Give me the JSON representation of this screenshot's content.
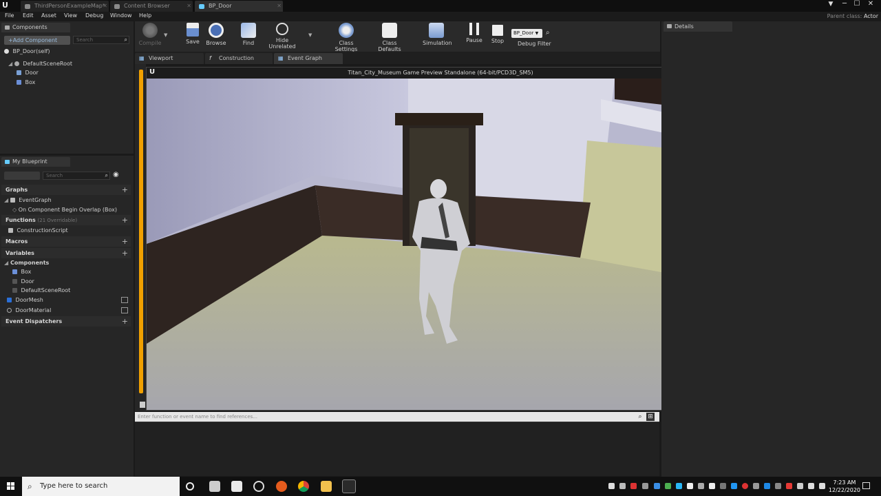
{
  "window": {
    "tabs": [
      {
        "label": "ThirdPersonExampleMap*"
      },
      {
        "label": "Content Browser"
      },
      {
        "label": "BP_Door"
      }
    ],
    "parent_class_label": "Parent class:",
    "parent_class_value": "Actor",
    "controls": {
      "minimize": "─",
      "maximize": "☐",
      "close": "✕"
    }
  },
  "menu": [
    "File",
    "Edit",
    "Asset",
    "View",
    "Debug",
    "Window",
    "Help"
  ],
  "components_panel": {
    "tab_label": "Components",
    "add_button": "+Add Component",
    "search_placeholder": "Search",
    "self_label": "BP_Door(self)",
    "tree": [
      {
        "label": "DefaultSceneRoot",
        "icon": "scene-root-icon"
      },
      {
        "label": "Door",
        "icon": "mesh-icon"
      },
      {
        "label": "Box",
        "icon": "box-collision-icon"
      }
    ]
  },
  "my_blueprint": {
    "tab_label": "My Blueprint",
    "search_placeholder": "Search",
    "graphs_header": "Graphs",
    "graphs": [
      {
        "label": "EventGraph"
      },
      {
        "label": "On Component Begin Overlap (Box)"
      }
    ],
    "functions_header": "Functions",
    "functions_sub": "(21 Overridable)",
    "functions": [
      {
        "label": "ConstructionScript"
      }
    ],
    "macros_header": "Macros",
    "variables_header": "Variables",
    "components_header": "Components",
    "components": [
      {
        "label": "Box"
      },
      {
        "label": "Door"
      },
      {
        "label": "DefaultSceneRoot"
      }
    ],
    "variables": [
      {
        "label": "DoorMesh"
      },
      {
        "label": "DoorMaterial"
      }
    ],
    "dispatchers_header": "Event Dispatchers"
  },
  "toolbar": {
    "compile": "Compile",
    "save": "Save",
    "browse": "Browse",
    "find": "Find",
    "hide_unrelated": "Hide Unrelated",
    "class_settings": "Class Settings",
    "class_defaults": "Class Defaults",
    "simulation": "Simulation",
    "pause": "Pause",
    "stop": "Stop",
    "debug_object": "BP_Door",
    "debug_filter": "Debug Filter"
  },
  "editor_tabs": [
    {
      "label": "Viewport"
    },
    {
      "label": "Construction Scrip"
    },
    {
      "label": "Event Graph"
    }
  ],
  "game_window": {
    "title": "Titan_City_Museum Game Preview Standalone (64-bit/PCD3D_SM5)"
  },
  "find_results": {
    "placeholder": "Enter function or event name to find references..."
  },
  "details_panel": {
    "tab_label": "Details"
  },
  "taskbar": {
    "search_placeholder": "Type here to search",
    "time": "7:23 AM",
    "date": "12/22/2020"
  }
}
